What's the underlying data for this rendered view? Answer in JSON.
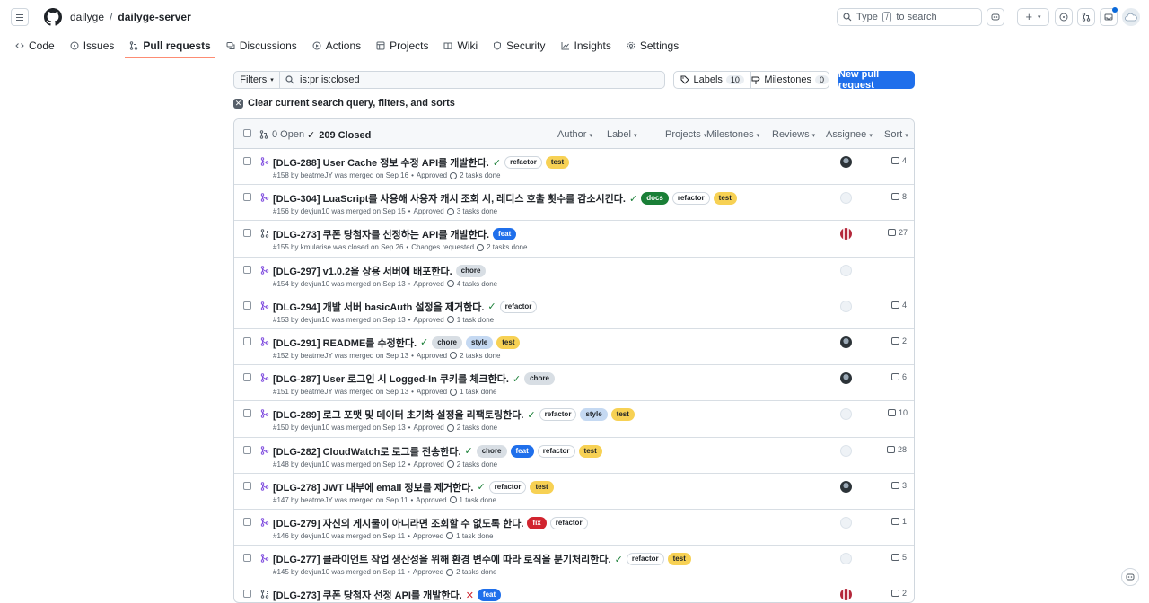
{
  "header": {
    "owner": "dailyge",
    "separator": "/",
    "repo": "dailyge-server",
    "search_placeholder": "Type",
    "search_key": "/",
    "search_suffix": "to search"
  },
  "nav": {
    "tabs": [
      {
        "label": "Code",
        "icon": "code-icon"
      },
      {
        "label": "Issues",
        "icon": "issue-icon"
      },
      {
        "label": "Pull requests",
        "icon": "pull-request-icon",
        "selected": true
      },
      {
        "label": "Discussions",
        "icon": "discussion-icon"
      },
      {
        "label": "Actions",
        "icon": "play-icon"
      },
      {
        "label": "Projects",
        "icon": "table-icon"
      },
      {
        "label": "Wiki",
        "icon": "book-icon"
      },
      {
        "label": "Security",
        "icon": "shield-icon"
      },
      {
        "label": "Insights",
        "icon": "graph-icon"
      },
      {
        "label": "Settings",
        "icon": "gear-icon"
      }
    ]
  },
  "toolbar": {
    "filters_label": "Filters",
    "query": "is:pr is:closed",
    "labels_label": "Labels",
    "labels_count": "10",
    "milestones_label": "Milestones",
    "milestones_count": "0",
    "new_pr_label": "New pull request",
    "clear_label": "Clear current search query, filters, and sorts"
  },
  "list_header": {
    "open": "0 Open",
    "closed": "209 Closed",
    "filters": [
      "Author",
      "Label",
      "Projects",
      "Milestones",
      "Reviews",
      "Assignee",
      "Sort"
    ]
  },
  "label_colors": {
    "refactor": {
      "bg": "#ffffff",
      "fg": "#1f2328",
      "border": "#d0d7de"
    },
    "test": {
      "bg": "#f7d154",
      "fg": "#1f2328",
      "border": "#f7d154"
    },
    "docs": {
      "bg": "#1a7f37",
      "fg": "#ffffff",
      "border": "#1a7f37"
    },
    "feat": {
      "bg": "#1f6feb",
      "fg": "#ffffff",
      "border": "#1f6feb"
    },
    "chore": {
      "bg": "#d8dee4",
      "fg": "#1f2328",
      "border": "#d8dee4"
    },
    "style": {
      "bg": "#c5d9f2",
      "fg": "#1f2328",
      "border": "#c5d9f2"
    },
    "fix": {
      "bg": "#d1242f",
      "fg": "#ffffff",
      "border": "#d1242f"
    }
  },
  "prs": [
    {
      "title": "[DLG-288] User Cache 정보 수정 API를 개발한다.",
      "status": "check",
      "labels": [
        "refactor",
        "test"
      ],
      "meta": "#158 by beatmeJY was merged on Sep 16",
      "review": "Approved",
      "tasks": "2 tasks done",
      "comments": "4",
      "merged": true,
      "avatar": "photo"
    },
    {
      "title": "[DLG-304] LuaScript를 사용해 사용자 캐시 조회 시, 레디스 호출 횟수를 감소시킨다.",
      "status": "check",
      "labels": [
        "docs",
        "refactor",
        "test"
      ],
      "meta": "#156 by devjun10 was merged on Sep 15",
      "review": "Approved",
      "tasks": "3 tasks done",
      "comments": "8",
      "merged": true,
      "avatar": "cloud"
    },
    {
      "title": "[DLG-273] 쿠폰 당첨자를 선정하는 API를 개발한다.",
      "status": "",
      "labels": [
        "feat"
      ],
      "meta": "#155 by kmularise was closed on Sep 26",
      "review": "Changes requested",
      "tasks": "2 tasks done",
      "comments": "27",
      "merged": false,
      "avatar": "pixel"
    },
    {
      "title": "[DLG-297] v1.0.2을 상용 서버에 배포한다.",
      "status": "",
      "labels": [
        "chore"
      ],
      "meta": "#154 by devjun10 was merged on Sep 13",
      "review": "Approved",
      "tasks": "4 tasks done",
      "comments": "",
      "merged": true,
      "avatar": "cloud"
    },
    {
      "title": "[DLG-294] 개발 서버 basicAuth 설정을 제거한다.",
      "status": "check",
      "labels": [
        "refactor"
      ],
      "meta": "#153 by devjun10 was merged on Sep 13",
      "review": "Approved",
      "tasks": "1 task done",
      "comments": "4",
      "merged": true,
      "avatar": "cloud"
    },
    {
      "title": "[DLG-291] README를 수정한다.",
      "status": "check",
      "labels": [
        "chore",
        "style",
        "test"
      ],
      "meta": "#152 by beatmeJY was merged on Sep 13",
      "review": "Approved",
      "tasks": "2 tasks done",
      "comments": "2",
      "merged": true,
      "avatar": "photo"
    },
    {
      "title": "[DLG-287] User 로그인 시 Logged-In 쿠키를 체크한다.",
      "status": "check",
      "labels": [
        "chore"
      ],
      "meta": "#151 by beatmeJY was merged on Sep 13",
      "review": "Approved",
      "tasks": "1 task done",
      "comments": "6",
      "merged": true,
      "avatar": "photo"
    },
    {
      "title": "[DLG-289] 로그 포맷 및 데이터 초기화 설정을 리팩토링한다.",
      "status": "check",
      "labels": [
        "refactor",
        "style",
        "test"
      ],
      "meta": "#150 by devjun10 was merged on Sep 13",
      "review": "Approved",
      "tasks": "2 tasks done",
      "comments": "10",
      "merged": true,
      "avatar": "cloud"
    },
    {
      "title": "[DLG-282] CloudWatch로 로그를 전송한다.",
      "status": "check",
      "labels": [
        "chore",
        "feat",
        "refactor",
        "test"
      ],
      "meta": "#148 by devjun10 was merged on Sep 12",
      "review": "Approved",
      "tasks": "2 tasks done",
      "comments": "28",
      "merged": true,
      "avatar": "cloud"
    },
    {
      "title": "[DLG-278] JWT 내부에 email 정보를 제거한다.",
      "status": "check",
      "labels": [
        "refactor",
        "test"
      ],
      "meta": "#147 by beatmeJY was merged on Sep 11",
      "review": "Approved",
      "tasks": "1 task done",
      "comments": "3",
      "merged": true,
      "avatar": "photo"
    },
    {
      "title": "[DLG-279] 자신의 게시물이 아니라면 조회할 수 없도록 한다.",
      "status": "",
      "labels": [
        "fix",
        "refactor"
      ],
      "meta": "#146 by devjun10 was merged on Sep 11",
      "review": "Approved",
      "tasks": "1 task done",
      "comments": "1",
      "merged": true,
      "avatar": "cloud"
    },
    {
      "title": "[DLG-277] 클라이언트 작업 생산성을 위해 환경 변수에 따라 로직을 분기처리한다.",
      "status": "check",
      "labels": [
        "refactor",
        "test"
      ],
      "meta": "#145 by devjun10 was merged on Sep 11",
      "review": "Approved",
      "tasks": "2 tasks done",
      "comments": "5",
      "merged": true,
      "avatar": "cloud"
    },
    {
      "title": "[DLG-273] 쿠폰 당첨자 선정 API를 개발한다.",
      "status": "x",
      "labels": [
        "feat"
      ],
      "meta": "",
      "review": "",
      "tasks": "",
      "comments": "2",
      "merged": false,
      "avatar": "pixel"
    }
  ]
}
